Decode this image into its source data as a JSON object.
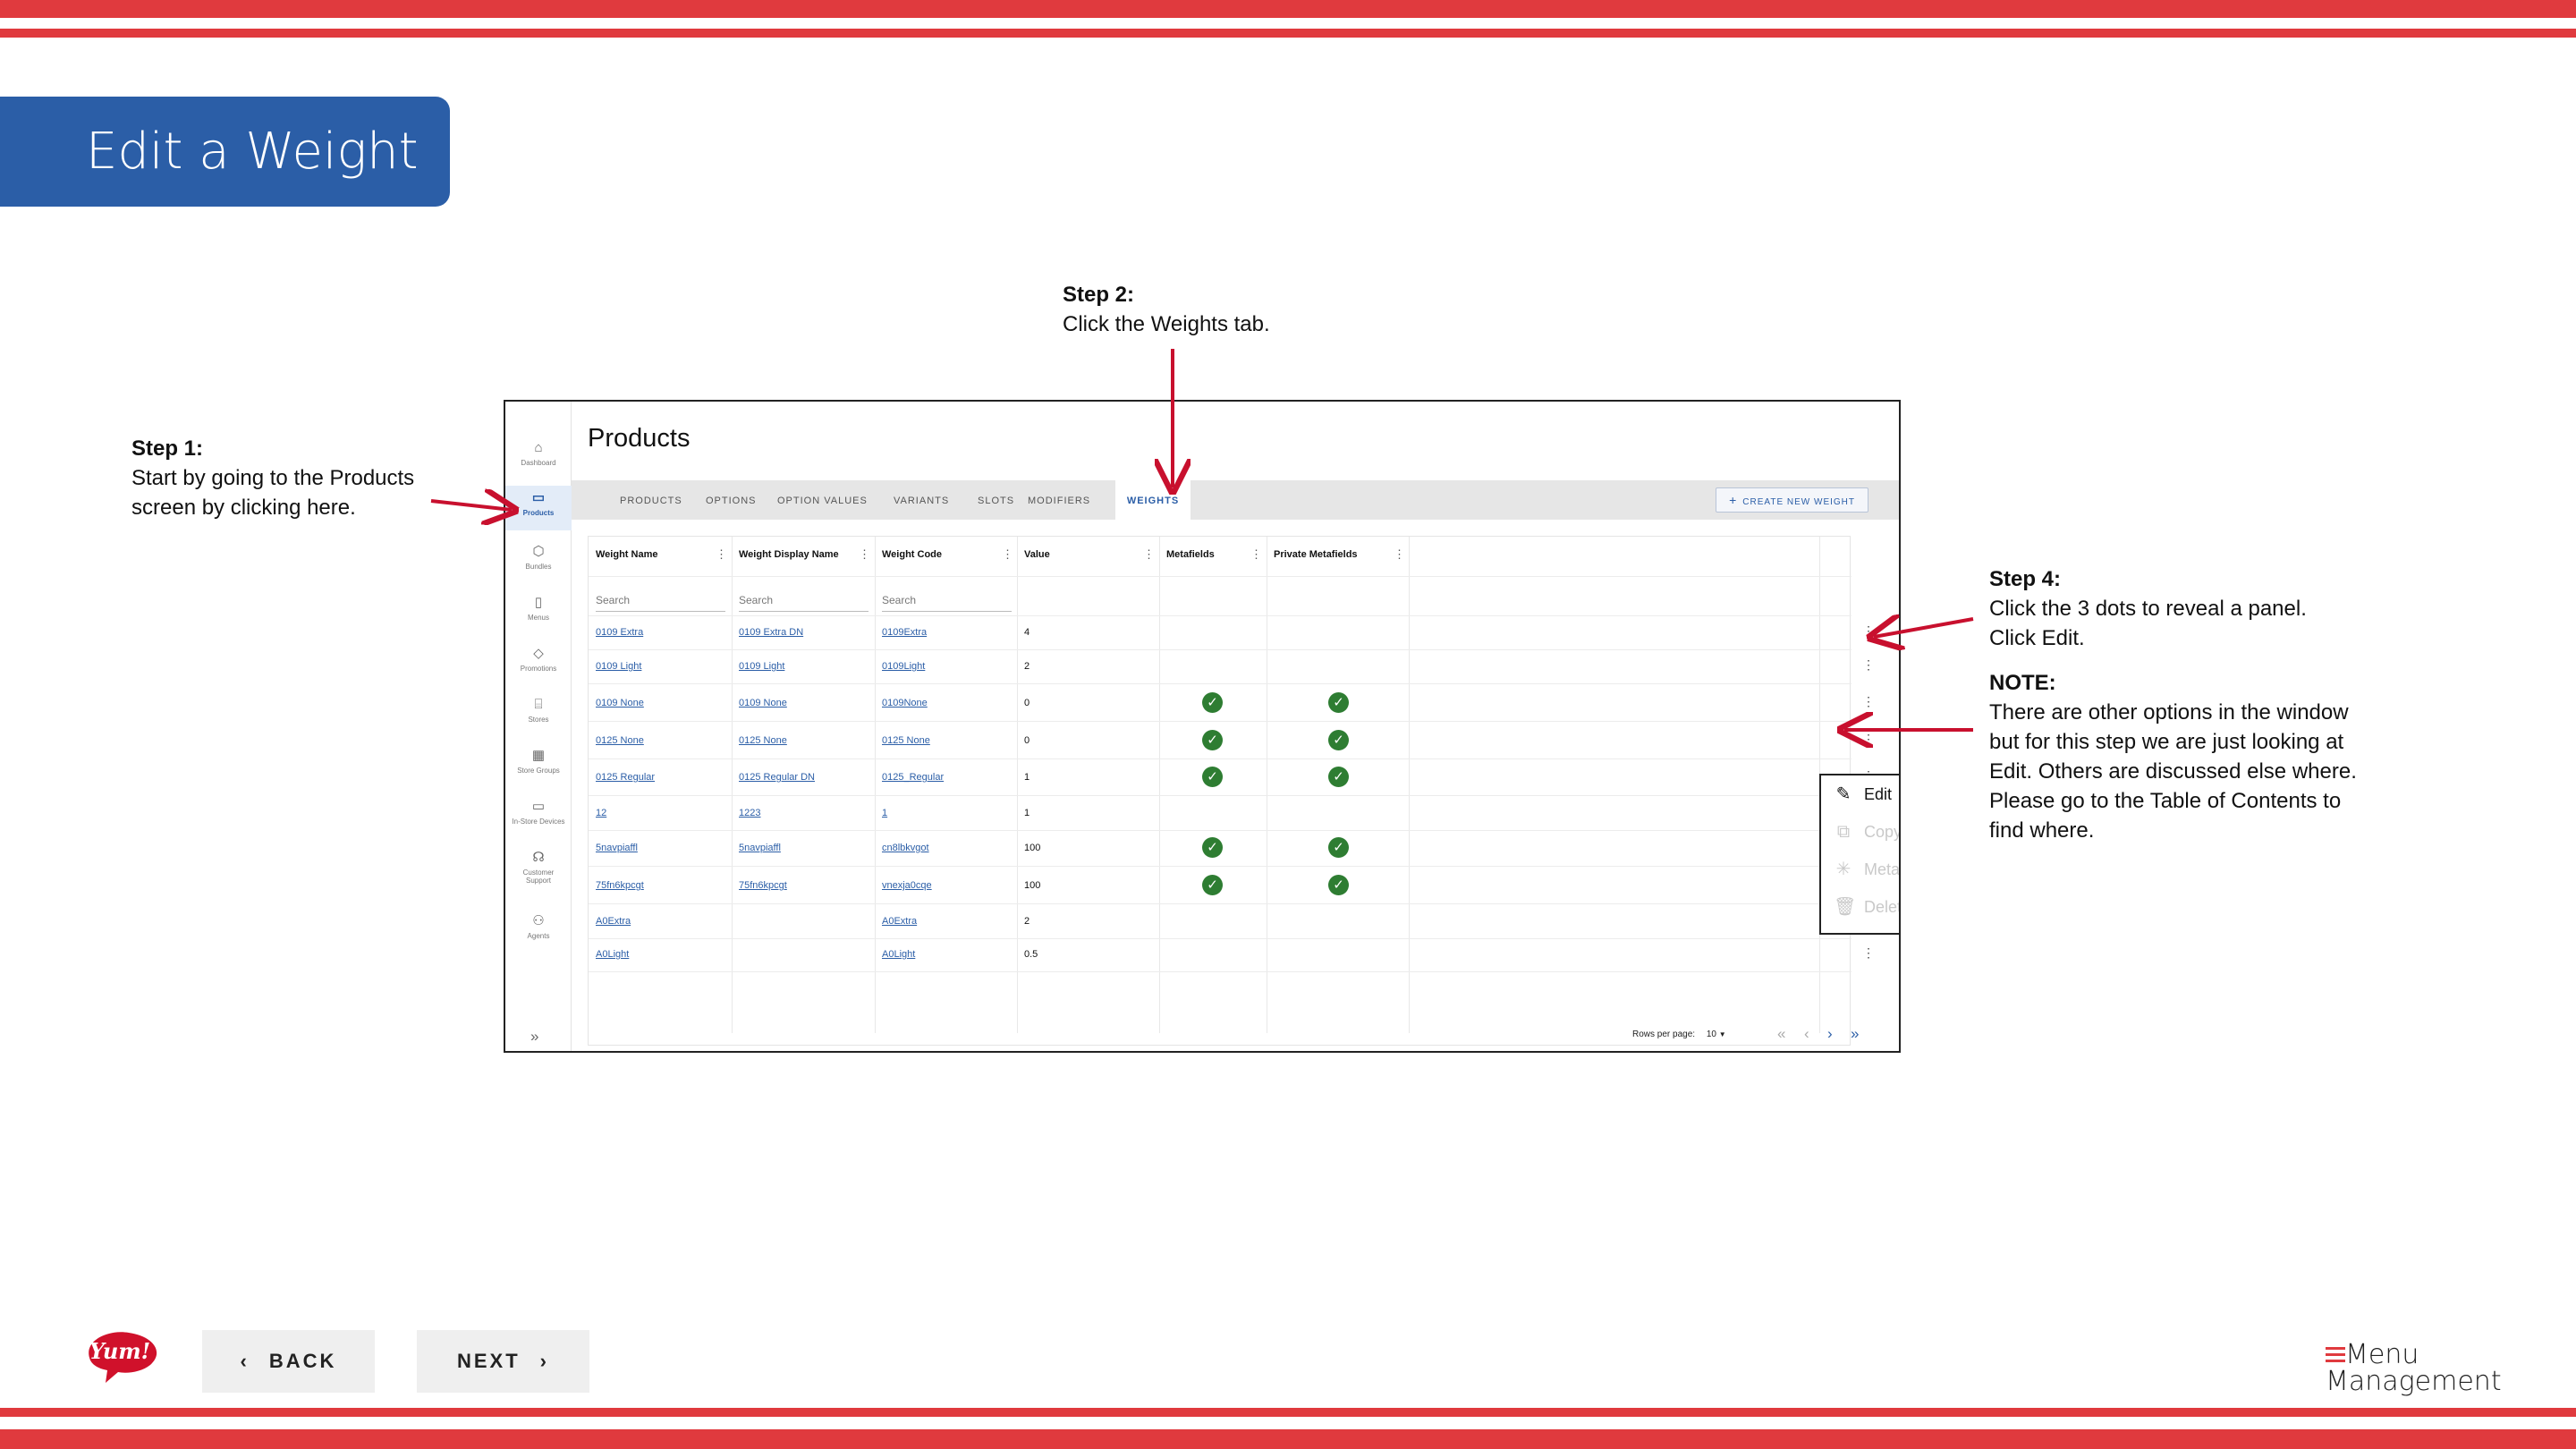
{
  "slide": {
    "title": "Edit a Weight",
    "colors": {
      "stripe": "#e03a3e",
      "title_bg": "#2b5ea7",
      "link": "#2b5ea7",
      "check": "#2e7d32"
    }
  },
  "steps": {
    "step1_title": "Step 1:",
    "step1_line1": "Start by going to the Products",
    "step1_line2": "screen by clicking here.",
    "step2_title": "Step 2:",
    "step2_line1": "Click the Weights tab.",
    "step4_title": "Step 4:",
    "step4_line1": "Click the 3 dots to reveal a panel.",
    "step4_line2": "Click Edit.",
    "note_title": "NOTE:",
    "note_lines": [
      "There are other options in the window",
      "but for this step we are just looking at",
      "Edit. Others are discussed else where.",
      "Please go to the Table of Contents to",
      "find where."
    ]
  },
  "app": {
    "page_title": "Products",
    "sidebar": [
      {
        "label": "Dashboard",
        "icon": "home-icon"
      },
      {
        "label": "Products",
        "icon": "box-icon",
        "active": true
      },
      {
        "label": "Bundles",
        "icon": "cube-icon"
      },
      {
        "label": "Menus",
        "icon": "document-icon"
      },
      {
        "label": "Promotions",
        "icon": "tag-icon"
      },
      {
        "label": "Stores",
        "icon": "store-icon"
      },
      {
        "label": "Store Groups",
        "icon": "grid-icon"
      },
      {
        "label": "In-Store Devices",
        "icon": "monitor-icon"
      },
      {
        "label": "Customer",
        "label2": "Support",
        "icon": "headset-icon"
      },
      {
        "label": "Agents",
        "icon": "people-icon"
      }
    ],
    "tabs": [
      "PRODUCTS",
      "OPTIONS",
      "OPTION VALUES",
      "VARIANTS",
      "SLOTS",
      "MODIFIERS",
      "WEIGHTS"
    ],
    "active_tab": "WEIGHTS",
    "create_button": "CREATE NEW WEIGHT",
    "columns": [
      "Weight Name",
      "Weight Display Name",
      "Weight Code",
      "Value",
      "Metafields",
      "Private Metafields"
    ],
    "search_placeholder": "Search",
    "rows": [
      {
        "name": "0109 Extra",
        "display": "0109 Extra DN",
        "code": "0109Extra",
        "value": "4",
        "meta": false,
        "private": false
      },
      {
        "name": "0109 Light",
        "display": "0109 Light",
        "code": "0109Light",
        "value": "2",
        "meta": false,
        "private": false
      },
      {
        "name": "0109 None",
        "display": "0109 None",
        "code": "0109None",
        "value": "0",
        "meta": true,
        "private": true
      },
      {
        "name": "0125 None",
        "display": "0125 None",
        "code": "0125 None",
        "value": "0",
        "meta": true,
        "private": true
      },
      {
        "name": "0125 Regular",
        "display": "0125 Regular DN",
        "code": "0125_Regular",
        "value": "1",
        "meta": true,
        "private": true
      },
      {
        "name": "12",
        "display": "1223",
        "code": "1",
        "value": "1",
        "meta": false,
        "private": false
      },
      {
        "name": "5navpiaffl",
        "display": "5navpiaffl",
        "code": "cn8lbkvgot",
        "value": "100",
        "meta": true,
        "private": true
      },
      {
        "name": "75fn6kpcgt",
        "display": "75fn6kpcgt",
        "code": "vnexja0cqe",
        "value": "100",
        "meta": true,
        "private": true
      },
      {
        "name": "A0Extra",
        "display": "",
        "code": "A0Extra",
        "value": "2",
        "meta": false,
        "private": false
      },
      {
        "name": "A0Light",
        "display": "",
        "code": "A0Light",
        "value": "0.5",
        "meta": false,
        "private": false
      }
    ],
    "context_menu": [
      {
        "label": "Edit",
        "icon": "edit-icon",
        "enabled": true
      },
      {
        "label": "Copy",
        "icon": "copy-icon",
        "enabled": false
      },
      {
        "label": "Meta",
        "icon": "asterisk-icon",
        "enabled": false
      },
      {
        "label": "Delete",
        "icon": "trash-icon",
        "enabled": false
      }
    ],
    "rows_per_page_label": "Rows per page:",
    "rows_per_page": "10"
  },
  "footer": {
    "back_label": "BACK",
    "next_label": "NEXT",
    "logo_text": "Yum!",
    "brand_line1": "Menu",
    "brand_line2": "Management"
  }
}
